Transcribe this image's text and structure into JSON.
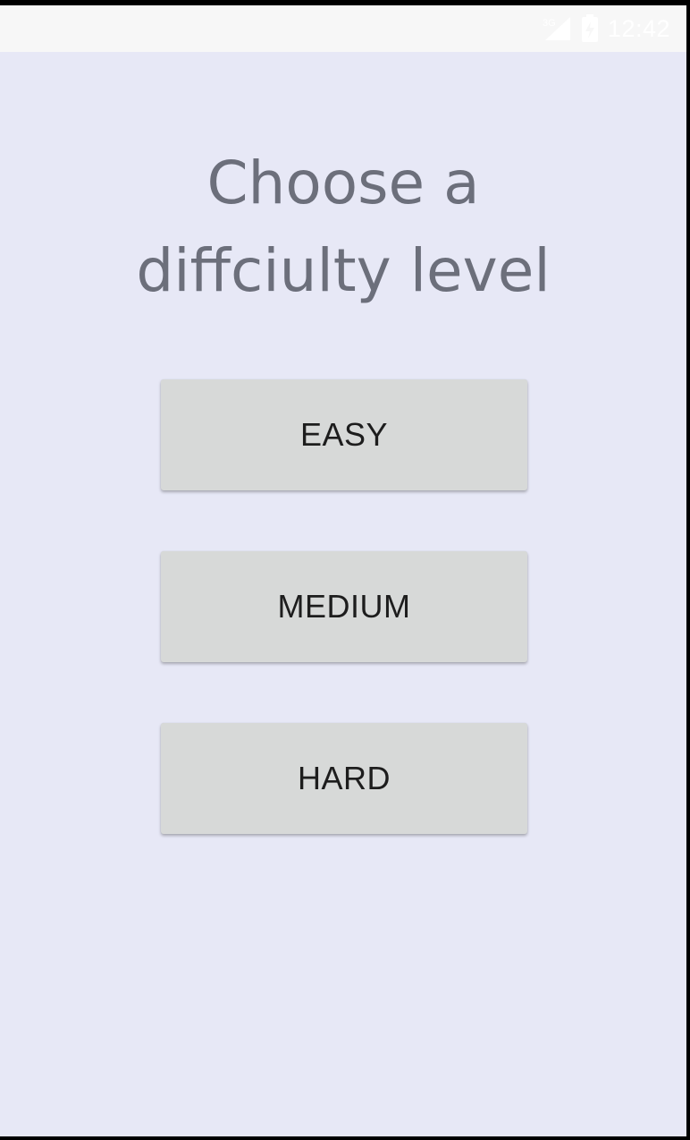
{
  "status_bar": {
    "network_label": "3G",
    "time": "12:42"
  },
  "title": {
    "line1": "Choose a",
    "line2": "diffciulty level"
  },
  "buttons": {
    "easy": "EASY",
    "medium": "MEDIUM",
    "hard": "HARD"
  },
  "colors": {
    "background": "#e7e8f6",
    "button": "#d7d9d8",
    "title_text": "#6c6f7b",
    "button_text": "#1d1d1d"
  },
  "icons": [
    "signal-icon",
    "battery-icon"
  ]
}
